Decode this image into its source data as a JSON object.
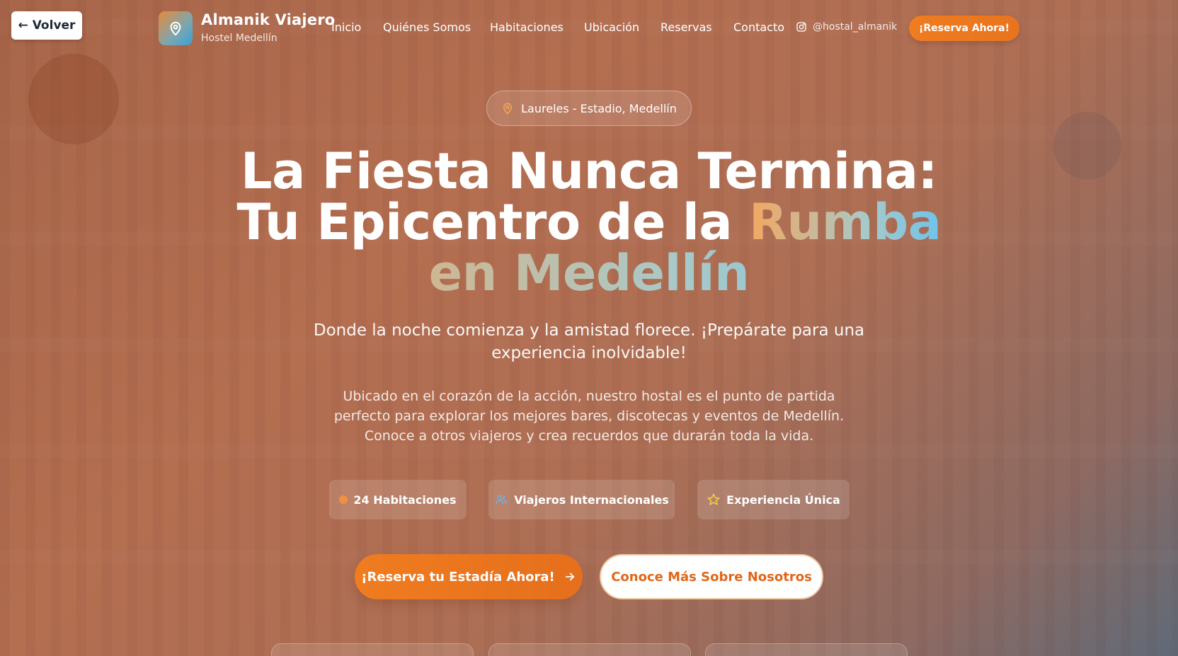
{
  "back_button": {
    "label": "← Volver"
  },
  "brand": {
    "name": "Almanik Viajero",
    "subtitle": "Hostel Medellín",
    "logo_icon": "map-pin-icon"
  },
  "nav": {
    "items": [
      "Inicio",
      "Quiénes Somos",
      "Habitaciones",
      "Ubicación",
      "Reservas",
      "Contacto"
    ],
    "instagram_handle": "@hostal_almanik",
    "instagram_icon": "instagram-icon",
    "reserve_label": "¡Reserva Ahora!"
  },
  "hero": {
    "location": "Laureles - Estadio, Medellín",
    "headline_line1": "La Fiesta Nunca Termina:",
    "headline_line2_plain": "Tu Epicentro de la ",
    "headline_line2_accent": "Rumba",
    "headline_line3_accent": "en Medellín",
    "lead": "Donde la noche comienza y la amistad florece. ¡Prepárate para una experiencia inolvidable!",
    "body": "Ubicado en el corazón de la acción, nuestro hostal es el punto de partida perfecto para explorar los mejores bares, discotecas y eventos de Medellín. Conoce a otros viajeros y crea recuerdos que durarán toda la vida."
  },
  "features": [
    {
      "label": "24 Habitaciones",
      "icon": "orange-dot-icon"
    },
    {
      "label": "Viajeros Internacionales",
      "icon": "users-icon"
    },
    {
      "label": "Experiencia Única",
      "icon": "star-icon"
    }
  ],
  "cta": {
    "primary": "¡Reserva tu Estadía Ahora!",
    "secondary": "Conoce Más Sobre Nosotros"
  },
  "colors": {
    "accent_orange": "#f07c20",
    "accent_blue": "#6ec3ea",
    "star_yellow": "#f5c84a",
    "users_blue": "#6fb6e6"
  }
}
